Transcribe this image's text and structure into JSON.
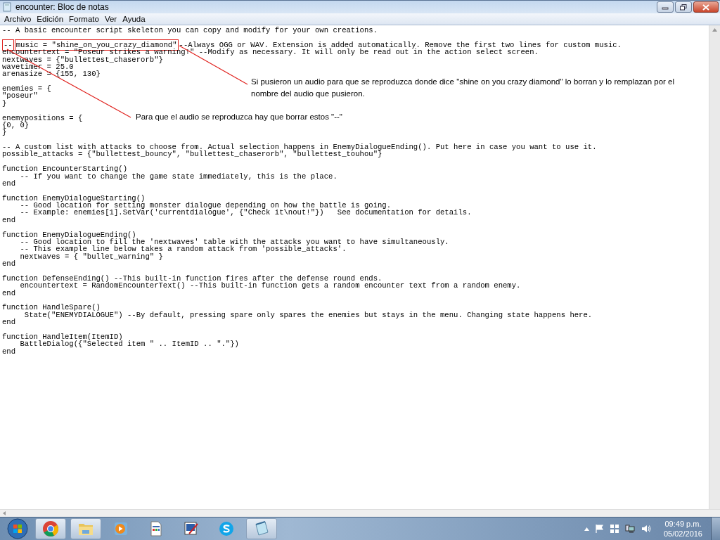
{
  "window": {
    "title": "encounter: Bloc de notas"
  },
  "menu": [
    "Archivo",
    "Edición",
    "Formato",
    "Ver",
    "Ayuda"
  ],
  "editor": {
    "blocks": [
      [
        "-- A basic encounter script skeleton you can copy and modify for your own creations."
      ],
      [
        [
          {
            "text": "--",
            "highlighted": true
          },
          {
            "text": "music = \"shine_on_you_crazy_diamond\"",
            "highlighted": true
          },
          {
            "text": "--Always OGG or WAV. Extension is added automatically. Remove the first two lines for custom music.",
            "highlighted": false
          }
        ],
        "encountertext = \"Poseur strikes a warning!\" --Modify as necessary. It will only be read out in the action select screen.",
        "nextwaves = {\"bullettest_chaserorb\"}",
        "wavetimer = 25.0",
        "arenasize = {155, 130}"
      ],
      [
        "enemies = {",
        "\"poseur\"",
        "}"
      ],
      [
        "enemypositions = {",
        "{0, 0}",
        "}"
      ],
      [
        "-- A custom list with attacks to choose from. Actual selection happens in EnemyDialogueEnding(). Put here in case you want to use it.",
        "possible_attacks = {\"bullettest_bouncy\", \"bullettest_chaserorb\", \"bullettest_touhou\"}"
      ],
      [
        "function EncounterStarting()",
        "    -- If you want to change the game state immediately, this is the place.",
        "end"
      ],
      [
        "function EnemyDialogueStarting()",
        "    -- Good location for setting monster dialogue depending on how the battle is going.",
        "    -- Example: enemies[1].SetVar('currentdialogue', {\"Check it\\nout!\"})   See documentation for details.",
        "end"
      ],
      [
        "function EnemyDialogueEnding()",
        "    -- Good location to fill the 'nextwaves' table with the attacks you want to have simultaneously.",
        "    -- This example line below takes a random attack from 'possible_attacks'.",
        "    nextwaves = { \"bullet_warning\" }",
        "end"
      ],
      [
        "function DefenseEnding() --This built-in function fires after the defense round ends.",
        "    encountertext = RandomEncounterText() --This built-in function gets a random encounter text from a random enemy.",
        "end"
      ],
      [
        "function HandleSpare()",
        "     State(\"ENEMYDIALOGUE\") --By default, pressing spare only spares the enemies but stays in the menu. Changing state happens here.",
        "end"
      ],
      [
        "function HandleItem(ItemID)",
        "    BattleDialog({\"Selected item \" .. ItemID .. \".\"})",
        "end"
      ]
    ]
  },
  "annotations": [
    {
      "kind": "callout",
      "text": "Si pusieron un audio para que se reproduzca donde dice \"shine on you crazy diamond\" lo borran y lo remplazan por el nombre del audio que pusieron."
    },
    {
      "kind": "callout",
      "text": "Para que el audio se reproduzca hay que borrar estos \"--\""
    }
  ],
  "taskbar": {
    "apps": [
      {
        "kind": "chrome",
        "running": true
      },
      {
        "kind": "folder",
        "running": true
      },
      {
        "kind": "media",
        "running": false
      },
      {
        "kind": "document",
        "running": false
      },
      {
        "kind": "paint",
        "running": false
      },
      {
        "kind": "skype",
        "running": false
      },
      {
        "kind": "notepad",
        "running": true
      }
    ],
    "clock": {
      "time": "09:49 p.m.",
      "date": "05/02/2016"
    }
  }
}
